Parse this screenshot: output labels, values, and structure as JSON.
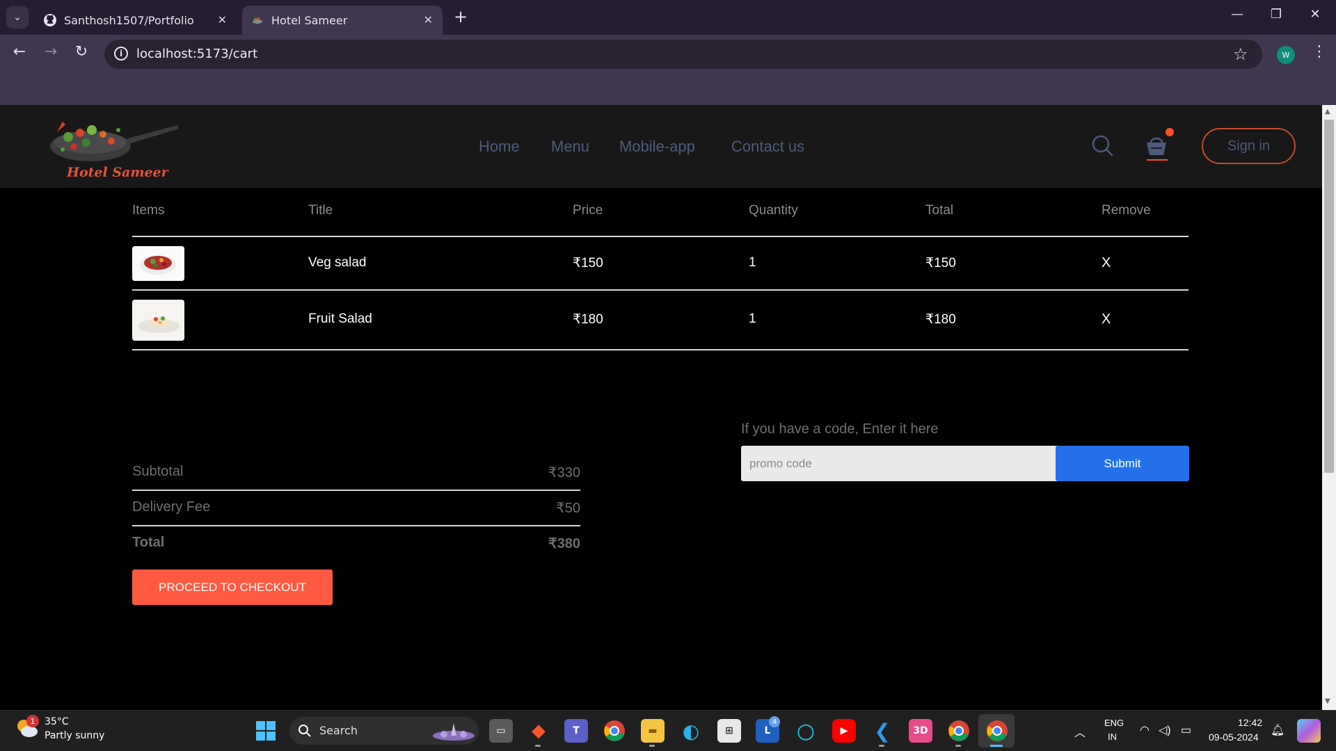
{
  "browser": {
    "tabs": [
      {
        "title": "Santhosh1507/Portfolio",
        "active": false,
        "icon": "github-icon"
      },
      {
        "title": "Hotel Sameer",
        "active": true,
        "icon": "site-favicon"
      }
    ],
    "new_tab_label": "+",
    "url": "localhost:5173/cart",
    "profile_initial": "W"
  },
  "site": {
    "logo_text": "Hotel Sameer",
    "nav": [
      "Home",
      "Menu",
      "Mobile-app",
      "Contact us"
    ],
    "sign_in_label": "Sign in"
  },
  "cart": {
    "headers": [
      "Items",
      "Title",
      "Price",
      "Quantity",
      "Total",
      "Remove"
    ],
    "rows": [
      {
        "title": "Veg salad",
        "price": "₹150",
        "quantity": "1",
        "total": "₹150",
        "remove": "X"
      },
      {
        "title": "Fruit Salad",
        "price": "₹180",
        "quantity": "1",
        "total": "₹180",
        "remove": "X"
      }
    ]
  },
  "totals": {
    "subtotal_label": "Subtotal",
    "subtotal_value": "₹330",
    "delivery_label": "Delivery Fee",
    "delivery_value": "₹50",
    "total_label": "Total",
    "total_value": "₹380",
    "checkout_label": "PROCEED TO CHECKOUT"
  },
  "promo": {
    "label": "If you have a code, Enter it here",
    "placeholder": "promo code",
    "submit_label": "Submit"
  },
  "taskbar": {
    "weather_temp": "35°C",
    "weather_desc": "Partly sunny",
    "weather_badge": "1",
    "search_label": "Search",
    "outlook_badge": "4",
    "lang_line1": "ENG",
    "lang_line2": "IN",
    "time": "12:42",
    "date": "09-05-2024"
  },
  "colors": {
    "accent": "#ff5a41",
    "submit_blue": "#2370ea",
    "nav_text": "#4c5a7c",
    "browser_frame": "#3f3650"
  }
}
